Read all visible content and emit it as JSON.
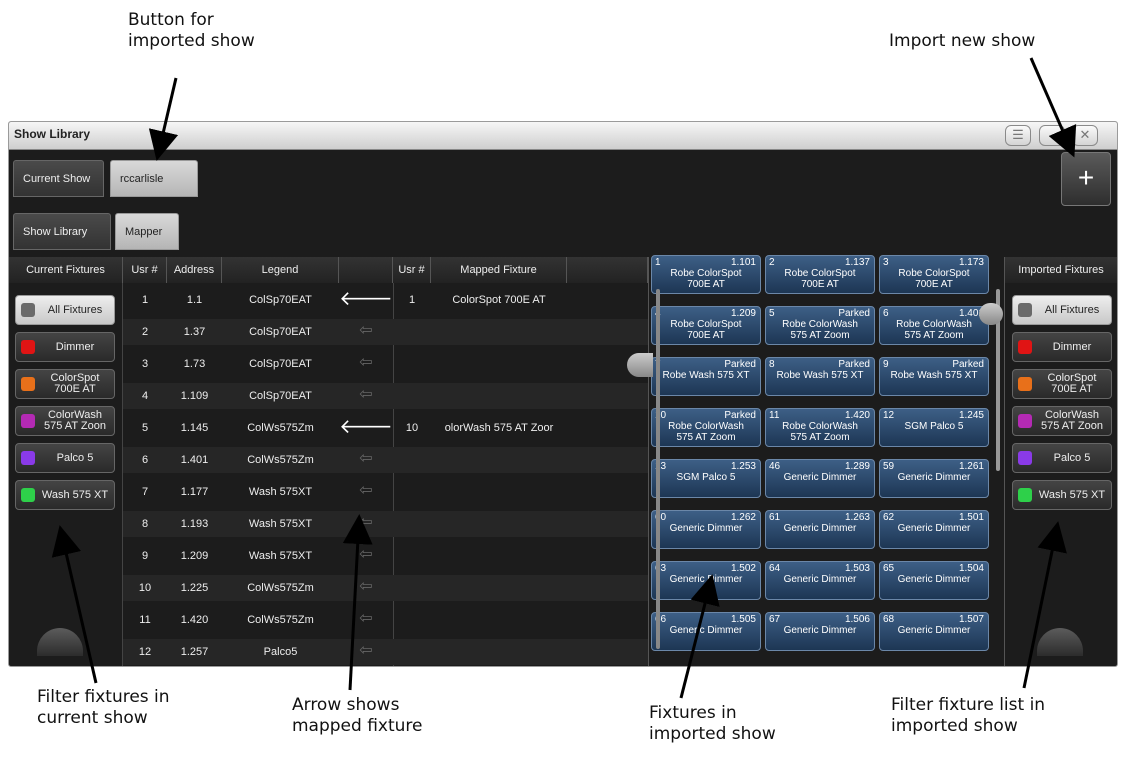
{
  "callouts": {
    "imported_show_button": "Button for\nimported show",
    "import_new_show": "Import new show",
    "filter_current": "Filter fixtures in\ncurrent show",
    "arrow_mapped": "Arrow shows\nmapped fixture",
    "fixtures_imported": "Fixtures in\nimported show",
    "filter_imported": "Filter fixture list in\nimported show"
  },
  "window": {
    "title": "Show Library"
  },
  "tabs": {
    "current_show": "Current Show",
    "imported_show": "rccarlisle",
    "show_library": "Show Library",
    "mapper": "Mapper",
    "import_symbol": "+"
  },
  "headers": {
    "current_fixtures": "Current Fixtures",
    "usr": "Usr #",
    "address": "Address",
    "legend": "Legend",
    "usr2": "Usr #",
    "mapped_fixture": "Mapped Fixture",
    "imported_fixtures": "Imported Fixtures"
  },
  "colors": {
    "all": "#6a6a6a",
    "dimmer": "#e01414",
    "colorspot": "#e8701a",
    "colorwash": "#b42ab4",
    "palco": "#8a3ae8",
    "wash": "#2ed04a"
  },
  "current_filters": [
    {
      "label": "All Fixtures",
      "color": "#6a6a6a",
      "selected": true
    },
    {
      "label": "Dimmer",
      "color": "#e01414"
    },
    {
      "label": "ColorSpot\n700E AT",
      "color": "#e8701a"
    },
    {
      "label": "ColorWash\n575 AT Zoon",
      "color": "#b42ab4"
    },
    {
      "label": "Palco 5",
      "color": "#8a3ae8"
    },
    {
      "label": "Wash 575 XT",
      "color": "#2ed04a"
    }
  ],
  "imported_filters": [
    {
      "label": "All Fixtures",
      "color": "#6a6a6a",
      "selected": true
    },
    {
      "label": "Dimmer",
      "color": "#e01414"
    },
    {
      "label": "ColorSpot\n700E AT",
      "color": "#e8701a"
    },
    {
      "label": "ColorWash\n575 AT Zoon",
      "color": "#b42ab4"
    },
    {
      "label": "Palco 5",
      "color": "#8a3ae8"
    },
    {
      "label": "Wash 575 XT",
      "color": "#2ed04a"
    }
  ],
  "rows": [
    {
      "usr": "1",
      "address": "1.1",
      "legend": "ColSp70EAT",
      "mapped": true,
      "musr": "1",
      "mfix": "ColorSpot 700E AT"
    },
    {
      "usr": "2",
      "address": "1.37",
      "legend": "ColSp70EAT",
      "mapped": false,
      "musr": "",
      "mfix": ""
    },
    {
      "usr": "3",
      "address": "1.73",
      "legend": "ColSp70EAT",
      "mapped": false,
      "musr": "",
      "mfix": ""
    },
    {
      "usr": "4",
      "address": "1.109",
      "legend": "ColSp70EAT",
      "mapped": false,
      "musr": "",
      "mfix": ""
    },
    {
      "usr": "5",
      "address": "1.145",
      "legend": "ColWs575Zm",
      "mapped": true,
      "musr": "10",
      "mfix": "olorWash 575 AT Zoor"
    },
    {
      "usr": "6",
      "address": "1.401",
      "legend": "ColWs575Zm",
      "mapped": false,
      "musr": "",
      "mfix": ""
    },
    {
      "usr": "7",
      "address": "1.177",
      "legend": "Wash 575XT",
      "mapped": false,
      "musr": "",
      "mfix": ""
    },
    {
      "usr": "8",
      "address": "1.193",
      "legend": "Wash 575XT",
      "mapped": false,
      "musr": "",
      "mfix": ""
    },
    {
      "usr": "9",
      "address": "1.209",
      "legend": "Wash 575XT",
      "mapped": false,
      "musr": "",
      "mfix": ""
    },
    {
      "usr": "10",
      "address": "1.225",
      "legend": "ColWs575Zm",
      "mapped": false,
      "musr": "",
      "mfix": ""
    },
    {
      "usr": "11",
      "address": "1.420",
      "legend": "ColWs575Zm",
      "mapped": false,
      "musr": "",
      "mfix": ""
    },
    {
      "usr": "12",
      "address": "1.257",
      "legend": "Palco5",
      "mapped": false,
      "musr": "",
      "mfix": ""
    }
  ],
  "arrow_glyphs": {
    "active": "🡐",
    "inactive": "⇦"
  },
  "tiles": [
    {
      "num": "1",
      "addr": "1.101",
      "name": "Robe ColorSpot\n700E AT"
    },
    {
      "num": "2",
      "addr": "1.137",
      "name": "Robe ColorSpot\n700E AT"
    },
    {
      "num": "3",
      "addr": "1.173",
      "name": "Robe ColorSpot\n700E AT"
    },
    {
      "num": "4",
      "addr": "1.209",
      "name": "Robe ColorSpot\n700E AT"
    },
    {
      "num": "5",
      "addr": "Parked",
      "name": "Robe ColorWash\n575 AT Zoom"
    },
    {
      "num": "6",
      "addr": "1.401",
      "name": "Robe ColorWash\n575 AT Zoom"
    },
    {
      "num": "7",
      "addr": "Parked",
      "name": "Robe Wash 575 XT"
    },
    {
      "num": "8",
      "addr": "Parked",
      "name": "Robe Wash 575 XT"
    },
    {
      "num": "9",
      "addr": "Parked",
      "name": "Robe Wash 575 XT"
    },
    {
      "num": "10",
      "addr": "Parked",
      "name": "Robe ColorWash\n575 AT Zoom"
    },
    {
      "num": "11",
      "addr": "1.420",
      "name": "Robe ColorWash\n575 AT Zoom"
    },
    {
      "num": "12",
      "addr": "1.245",
      "name": "SGM Palco 5"
    },
    {
      "num": "13",
      "addr": "1.253",
      "name": "SGM Palco 5"
    },
    {
      "num": "46",
      "addr": "1.289",
      "name": "Generic Dimmer"
    },
    {
      "num": "59",
      "addr": "1.261",
      "name": "Generic Dimmer"
    },
    {
      "num": "60",
      "addr": "1.262",
      "name": "Generic Dimmer"
    },
    {
      "num": "61",
      "addr": "1.263",
      "name": "Generic Dimmer"
    },
    {
      "num": "62",
      "addr": "1.501",
      "name": "Generic Dimmer"
    },
    {
      "num": "63",
      "addr": "1.502",
      "name": "Generic Dimmer"
    },
    {
      "num": "64",
      "addr": "1.503",
      "name": "Generic Dimmer"
    },
    {
      "num": "65",
      "addr": "1.504",
      "name": "Generic Dimmer"
    },
    {
      "num": "66",
      "addr": "1.505",
      "name": "Generic Dimmer"
    },
    {
      "num": "67",
      "addr": "1.506",
      "name": "Generic Dimmer"
    },
    {
      "num": "68",
      "addr": "1.507",
      "name": "Generic Dimmer"
    }
  ]
}
